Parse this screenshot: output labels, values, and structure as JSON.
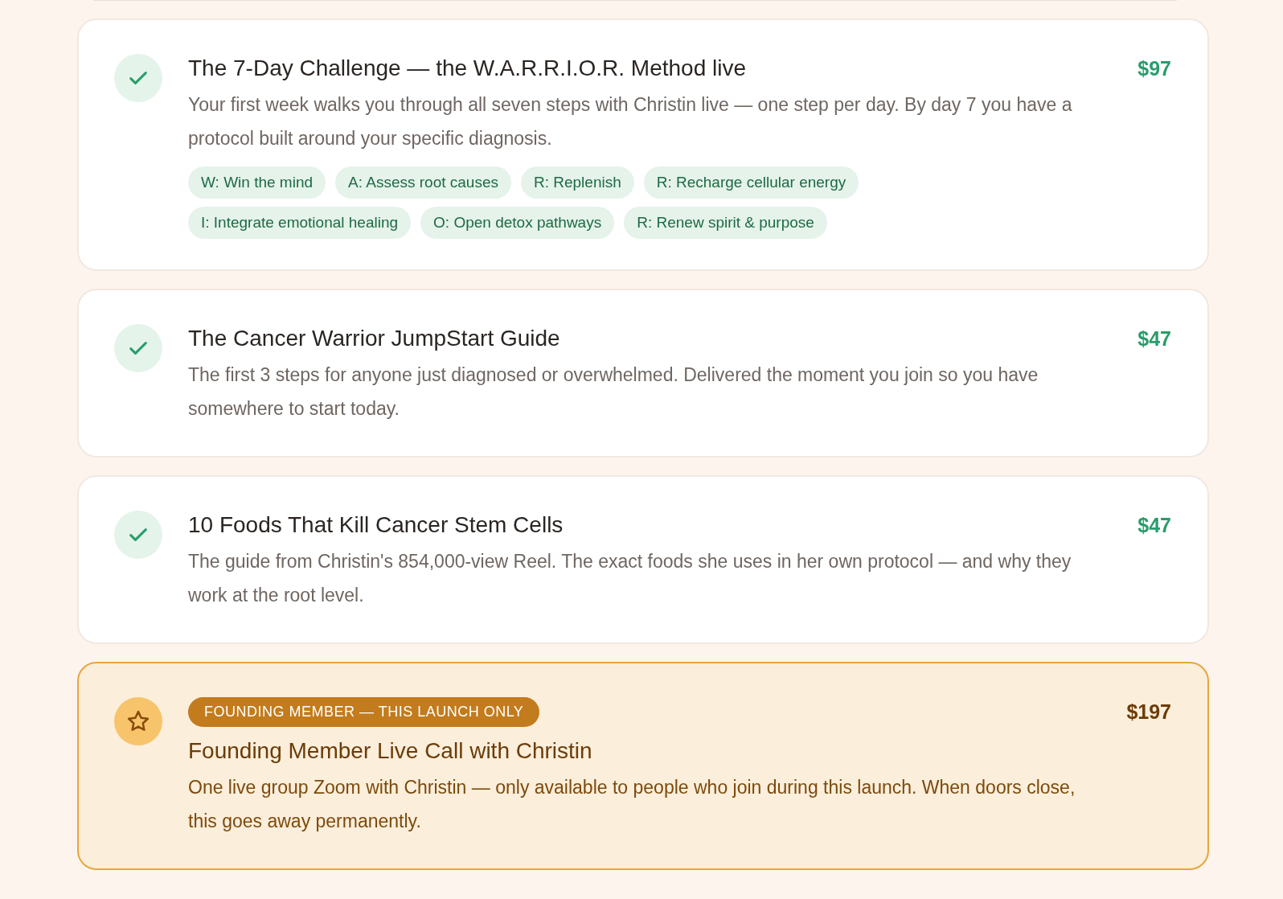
{
  "offers": [
    {
      "kind": "included",
      "title": "The 7-Day Challenge — the W.A.R.R.I.O.R. Method live",
      "price": "$97",
      "description": "Your first week walks you through all seven steps with Christin live — one step per day. By day 7 you have a protocol built around your specific diagnosis.",
      "tags": [
        "W: Win the mind",
        "A: Assess root causes",
        "R: Replenish",
        "R: Recharge cellular energy",
        "I: Integrate emotional healing",
        "O: Open detox pathways",
        "R: Renew spirit & purpose"
      ]
    },
    {
      "kind": "included",
      "title": "The Cancer Warrior JumpStart Guide",
      "price": "$47",
      "description": "The first 3 steps for anyone just diagnosed or overwhelmed. Delivered the moment you join so you have somewhere to start today."
    },
    {
      "kind": "included",
      "title": "10 Foods That Kill Cancer Stem Cells",
      "price": "$47",
      "description": "The guide from Christin's 854,000-view Reel. The exact foods she uses in her own protocol — and why they work at the root level."
    },
    {
      "kind": "featured",
      "badge": "FOUNDING MEMBER — THIS LAUNCH ONLY",
      "title": "Founding Member Live Call with Christin",
      "price": "$197",
      "description": "One live group Zoom with Christin — only available to people who join during this launch. When doors close, this goes away permanently."
    }
  ]
}
